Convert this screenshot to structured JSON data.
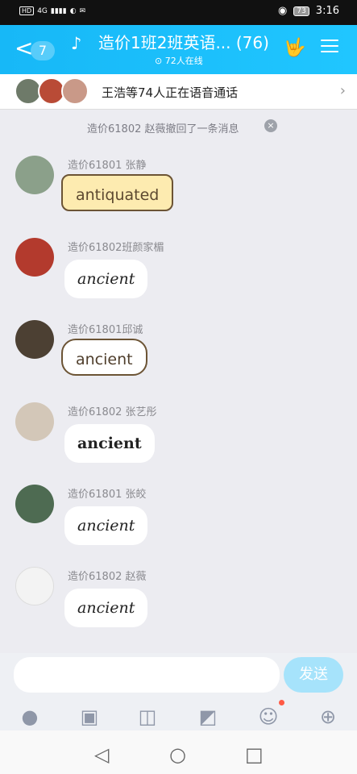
{
  "status": {
    "left": [
      "HD",
      "4G",
      "▮▮▮▮",
      "◐",
      "✉"
    ],
    "battery": "73",
    "time": "3:16"
  },
  "header": {
    "back_label": "<",
    "back_count": "7",
    "title": "造价1班2班英语... (76)",
    "online": "⊙ 72人在线"
  },
  "voice": {
    "text": "王浩等74人正在语音通话"
  },
  "system": {
    "text": "造价61802 赵薇撤回了一条消息"
  },
  "messages": [
    {
      "name": "造价61801 张静",
      "text": "antiquated"
    },
    {
      "name": "造价61802班颜家楣",
      "text": "ancient"
    },
    {
      "name": "造价61801邱诚",
      "text": "ancient"
    },
    {
      "name": "造价61802 张艺彤",
      "text": "ancient"
    },
    {
      "name": "造价61801   张皎",
      "text": "ancient"
    },
    {
      "name": "造价61802 赵薇",
      "text": "ancient"
    }
  ],
  "composer": {
    "send_label": "发送"
  },
  "icons": [
    "microphone-icon",
    "image-icon",
    "camera-icon",
    "red-packet-icon",
    "emoji-icon",
    "plus-icon"
  ]
}
